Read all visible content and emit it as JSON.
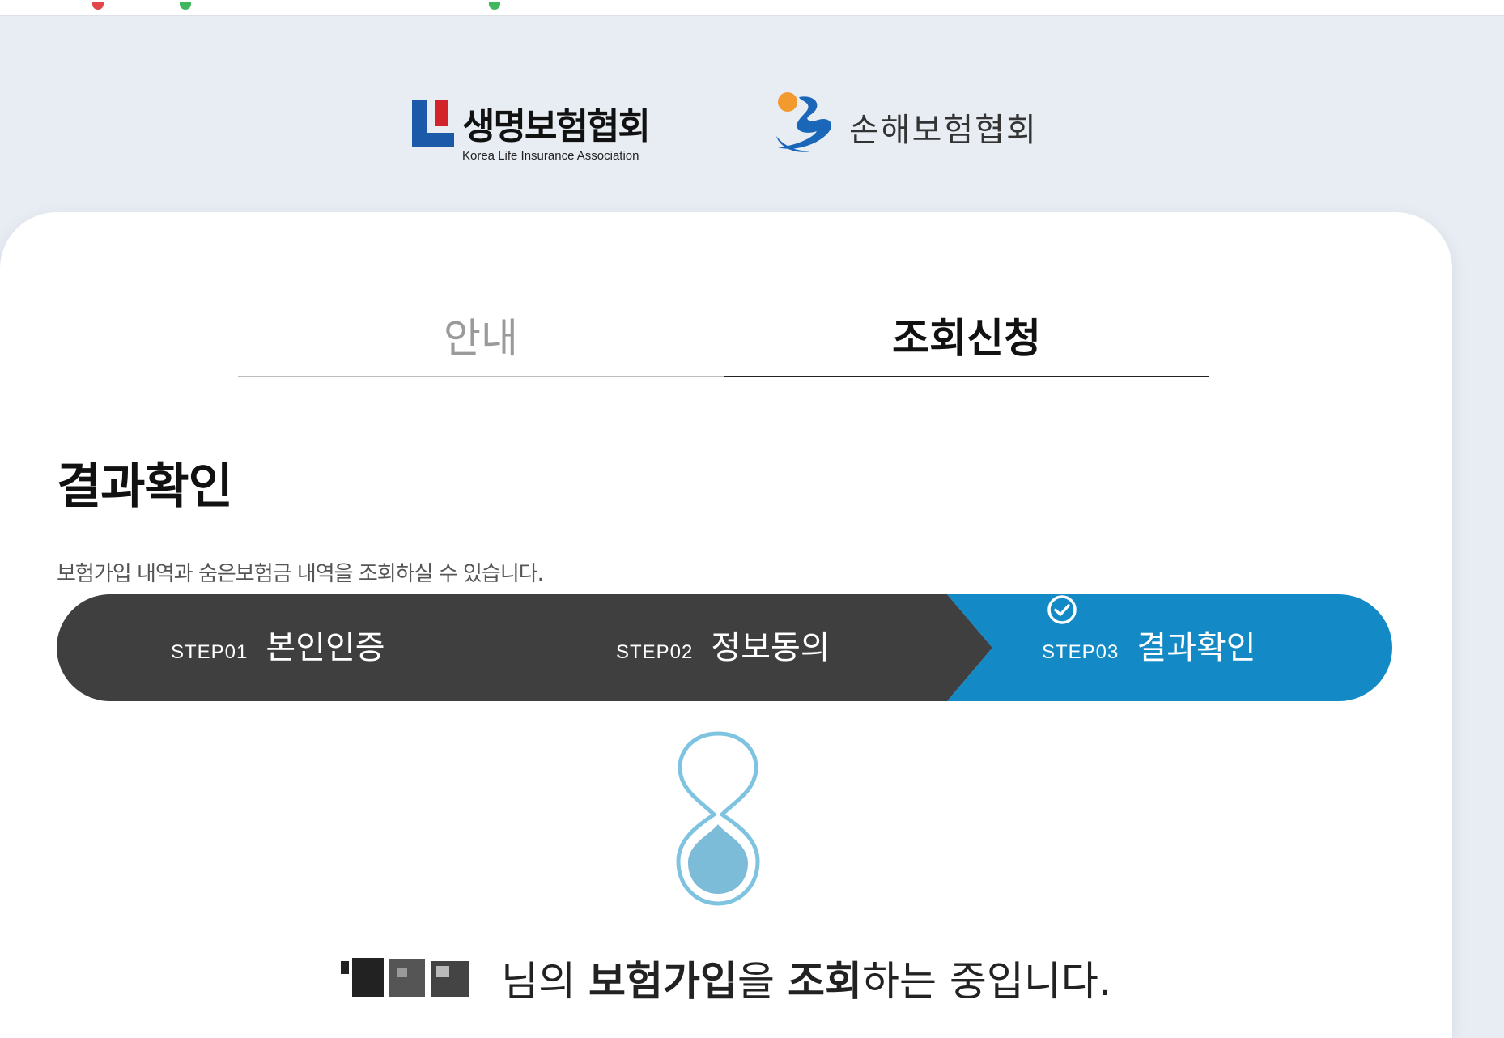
{
  "header": {
    "life_association": {
      "korean_name": "생명보험협회",
      "english_name": "Korea Life Insurance Association"
    },
    "nonlife_association": {
      "korean_name": "손해보험협회"
    }
  },
  "tabs": [
    {
      "label": "안내",
      "active": false
    },
    {
      "label": "조회신청",
      "active": true
    }
  ],
  "page": {
    "title": "결과확인",
    "description": "보험가입 내역과 숨은보험금 내역을 조회하실 수 있습니다."
  },
  "steps": [
    {
      "number": "STEP01",
      "label": "본인인증",
      "active": false
    },
    {
      "number": "STEP02",
      "label": "정보동의",
      "active": false
    },
    {
      "number": "STEP03",
      "label": "결과확인",
      "active": true
    }
  ],
  "status": {
    "suffix_1": " 님의 ",
    "bold_1": "보험가입",
    "part_2": "을 ",
    "bold_2": "조회",
    "part_3": "하는 중입니다."
  },
  "colors": {
    "background": "#e8edf3",
    "step_dark": "#3f3f3f",
    "step_active": "#138ac6",
    "hourglass_outline": "#7ec3df",
    "hourglass_fill": "#7dbcd8"
  },
  "icons": {
    "step3_check": "check-circle-icon",
    "loader": "hourglass-icon"
  }
}
